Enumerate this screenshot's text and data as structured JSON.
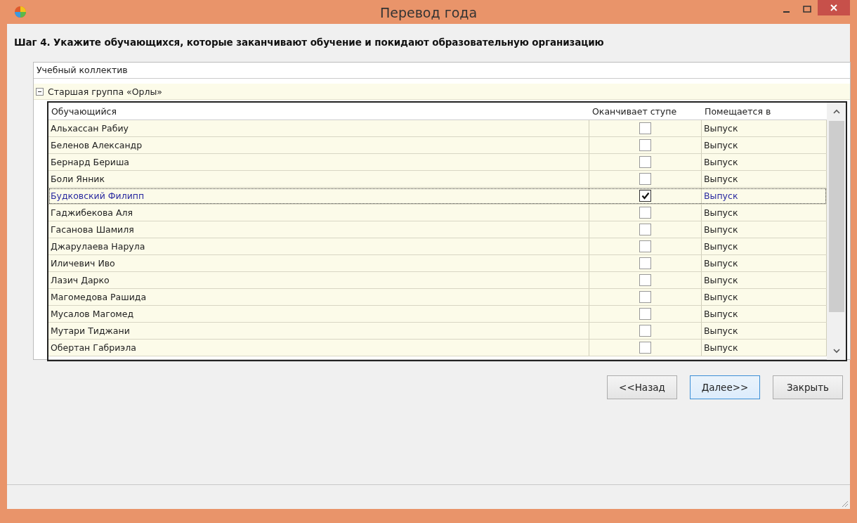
{
  "window": {
    "title": "Перевод года"
  },
  "heading": "Шаг 4. Укажите обучающихся, которые заканчивают обучение и покидают образовательную организацию",
  "group_header": "Учебный коллектив",
  "group": {
    "label": "Старшая группа «Орлы»",
    "expanded": true
  },
  "table": {
    "columns": [
      "Обучающийся",
      "Оканчивает ступе",
      "Помещается в"
    ],
    "rows": [
      {
        "name": "Альхассан Рабиу",
        "checked": false,
        "destination": "Выпуск",
        "selected": false
      },
      {
        "name": "Беленов Александр",
        "checked": false,
        "destination": "Выпуск",
        "selected": false
      },
      {
        "name": "Бернард Бериша",
        "checked": false,
        "destination": "Выпуск",
        "selected": false
      },
      {
        "name": "Боли Янник",
        "checked": false,
        "destination": "Выпуск",
        "selected": false
      },
      {
        "name": "Будковский Филипп",
        "checked": true,
        "destination": "Выпуск",
        "selected": true
      },
      {
        "name": "Гаджибекова Аля",
        "checked": false,
        "destination": "Выпуск",
        "selected": false
      },
      {
        "name": "Гасанова Шамиля",
        "checked": false,
        "destination": "Выпуск",
        "selected": false
      },
      {
        "name": "Джарулаева Нарула",
        "checked": false,
        "destination": "Выпуск",
        "selected": false
      },
      {
        "name": "Иличевич Иво",
        "checked": false,
        "destination": "Выпуск",
        "selected": false
      },
      {
        "name": "Лазич Дарко",
        "checked": false,
        "destination": "Выпуск",
        "selected": false
      },
      {
        "name": "Магомедова Рашида",
        "checked": false,
        "destination": "Выпуск",
        "selected": false
      },
      {
        "name": "Мусалов Магомед",
        "checked": false,
        "destination": "Выпуск",
        "selected": false
      },
      {
        "name": "Мутари Тиджани",
        "checked": false,
        "destination": "Выпуск",
        "selected": false
      },
      {
        "name": "Обертан Габриэла",
        "checked": false,
        "destination": "Выпуск",
        "selected": false
      }
    ]
  },
  "buttons": [
    {
      "label": "<<Назад",
      "selected": false
    },
    {
      "label": "Далее>>",
      "selected": true
    },
    {
      "label": "Закрыть",
      "selected": false
    }
  ]
}
